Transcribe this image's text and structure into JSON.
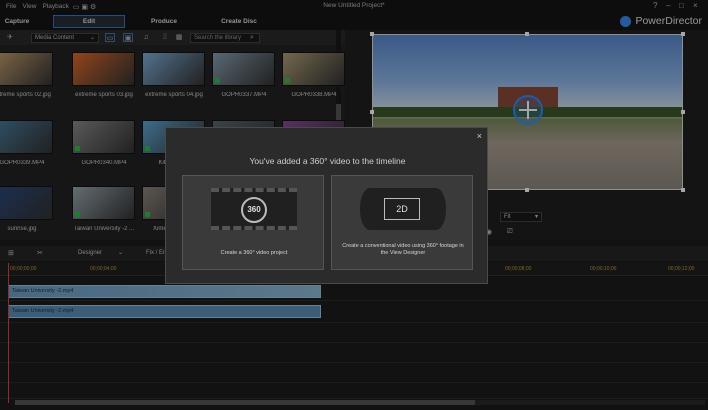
{
  "menu": {
    "items": [
      "File",
      "View",
      "Playback"
    ],
    "document_title": "New Untitled Project*"
  },
  "modes": {
    "tabs": [
      {
        "label": "Capture",
        "active": false
      },
      {
        "label": "Edit",
        "active": true
      },
      {
        "label": "Produce",
        "active": false
      },
      {
        "label": "Create Disc",
        "active": false
      }
    ],
    "brand": "PowerDirector"
  },
  "media": {
    "dropdown": "Media Content",
    "search_placeholder": "Search the library",
    "items": [
      {
        "label": "extreme sports 02.jpg",
        "type": "image",
        "color": "#c9a370"
      },
      {
        "label": "extreme sports 03.jpg",
        "type": "image",
        "color": "#e06a2a"
      },
      {
        "label": "extreme sports 04.jpg",
        "type": "image",
        "color": "#7fb0d8"
      },
      {
        "label": "GOPR0337.MP4",
        "type": "video",
        "color": "#8aa0b0"
      },
      {
        "label": "GOPR0338.MP4",
        "type": "video",
        "color": "#b0a078"
      },
      {
        "label": "GOPR0339.MP4",
        "type": "video",
        "color": "#4a7fa0"
      },
      {
        "label": "GOPR0340.MP4",
        "type": "video",
        "color": "#8a8a8a"
      },
      {
        "label": "Kite Surfing",
        "type": "video",
        "color": "#5fa8d6"
      },
      {
        "label": "",
        "type": "video",
        "color": "#5a6a70"
      },
      {
        "label": "",
        "type": "video",
        "color": "#8a4a9a"
      },
      {
        "label": "sunrise.jpg",
        "type": "image",
        "color": "#2a4a80"
      },
      {
        "label": "Taiwan University -2 ...",
        "type": "video",
        "color": "#9aa8b0"
      },
      {
        "label": "Ximending-2_...",
        "type": "video",
        "color": "#8f857a"
      }
    ]
  },
  "preview": {
    "fit_label": "Fit"
  },
  "timeline": {
    "designer_label": "Designer",
    "fix_label": "Fix / Er",
    "ruler": [
      "00;00;00;00",
      "00;00;04;00",
      "00;00;06;00",
      "00;00;08;00",
      "00;00;10;00",
      "00;00;12;00"
    ],
    "clips": [
      "Taiwan University -2.mp4",
      "Taiwan University -2.mp4"
    ]
  },
  "dialog": {
    "title": "You've added a 360° video to the timeline",
    "close": "×",
    "option_360": {
      "badge": "360",
      "caption": "Create a 360° video project"
    },
    "option_2d": {
      "badge": "2D",
      "caption": "Create a conventional video using 360° footage in the View Designer"
    }
  }
}
